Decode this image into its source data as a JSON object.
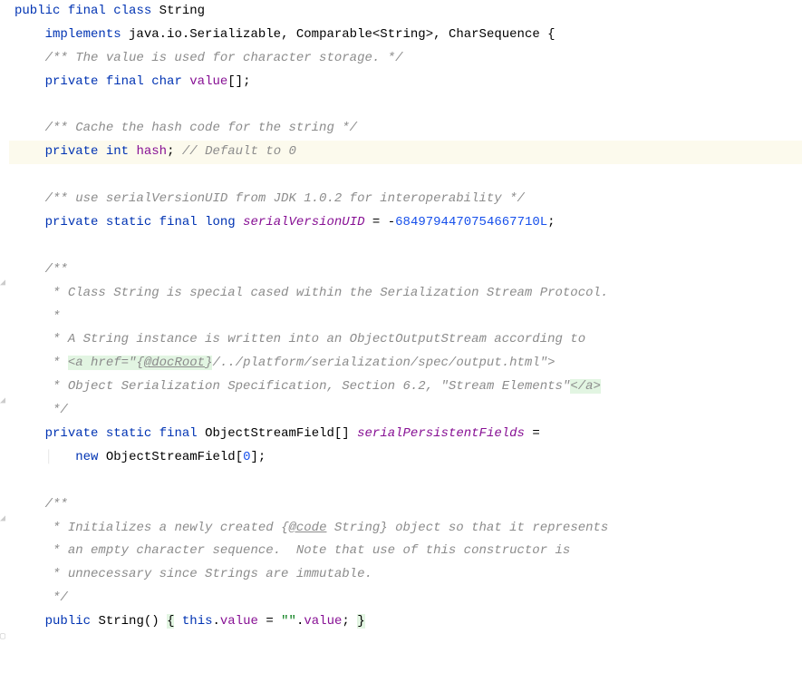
{
  "lines": {
    "l1": {
      "kw_public": "public",
      "kw_final": "final",
      "kw_class": "class",
      "cls_name": "String"
    },
    "l2": {
      "kw_implements": "implements",
      "pkg": "java.io.Serializable",
      "comp": "Comparable",
      "gen": "String",
      "cs": "CharSequence"
    },
    "l3": {
      "comment": "/** The value is used for character storage. */"
    },
    "l4": {
      "kw_private": "private",
      "kw_final": "final",
      "kw_char": "char",
      "field": "value"
    },
    "l6": {
      "comment": "/** Cache the hash code for the string */"
    },
    "l7": {
      "kw_private": "private",
      "kw_int": "int",
      "field": "hash",
      "comment": "// Default to 0"
    },
    "l9": {
      "comment": "/** use serialVersionUID from JDK 1.0.2 for interoperability */"
    },
    "l10": {
      "kw_private": "private",
      "kw_static": "static",
      "kw_final": "final",
      "kw_long": "long",
      "field": "serialVersionUID",
      "num": "6849794470754667710L"
    },
    "l12": {
      "open": "/**"
    },
    "l13": {
      "text": " * Class String is special cased within the Serialization Stream Protocol."
    },
    "l14": {
      "text": " *"
    },
    "l15": {
      "text": " * A String instance is written into an ObjectOutputStream according to"
    },
    "l16": {
      "star": " * ",
      "html_open": "<a href=\"{",
      "tag": "@docRoot",
      "html_mid": "}",
      "rest": "/../platform/serialization/spec/output.html\">"
    },
    "l17": {
      "star": " * ",
      "text": "Object Serialization Specification, Section 6.2, \"Stream Elements\"",
      "html_close": "</a>"
    },
    "l18": {
      "close": " */"
    },
    "l19": {
      "kw_private": "private",
      "kw_static": "static",
      "kw_final": "final",
      "type": "ObjectStreamField",
      "field": "serialPersistentFields"
    },
    "l20": {
      "kw_new": "new",
      "type": "ObjectStreamField",
      "num": "0"
    },
    "l22": {
      "open": "/**"
    },
    "l23": {
      "star": " * ",
      "text1": "Initializes a newly created {",
      "tag": "@code",
      "text2": " String} object so that it represents"
    },
    "l24": {
      "text": " * an empty character sequence.  Note that use of this constructor is"
    },
    "l25": {
      "text": " * unnecessary since Strings are immutable."
    },
    "l26": {
      "close": " */"
    },
    "l27": {
      "kw_public": "public",
      "ctor": "String",
      "kw_this": "this",
      "field": "value",
      "str": "\"\"",
      "field2": "value"
    }
  },
  "gutter": {
    "i1": "◢",
    "i2": "◢",
    "i3": "◢",
    "i4": "▢"
  }
}
